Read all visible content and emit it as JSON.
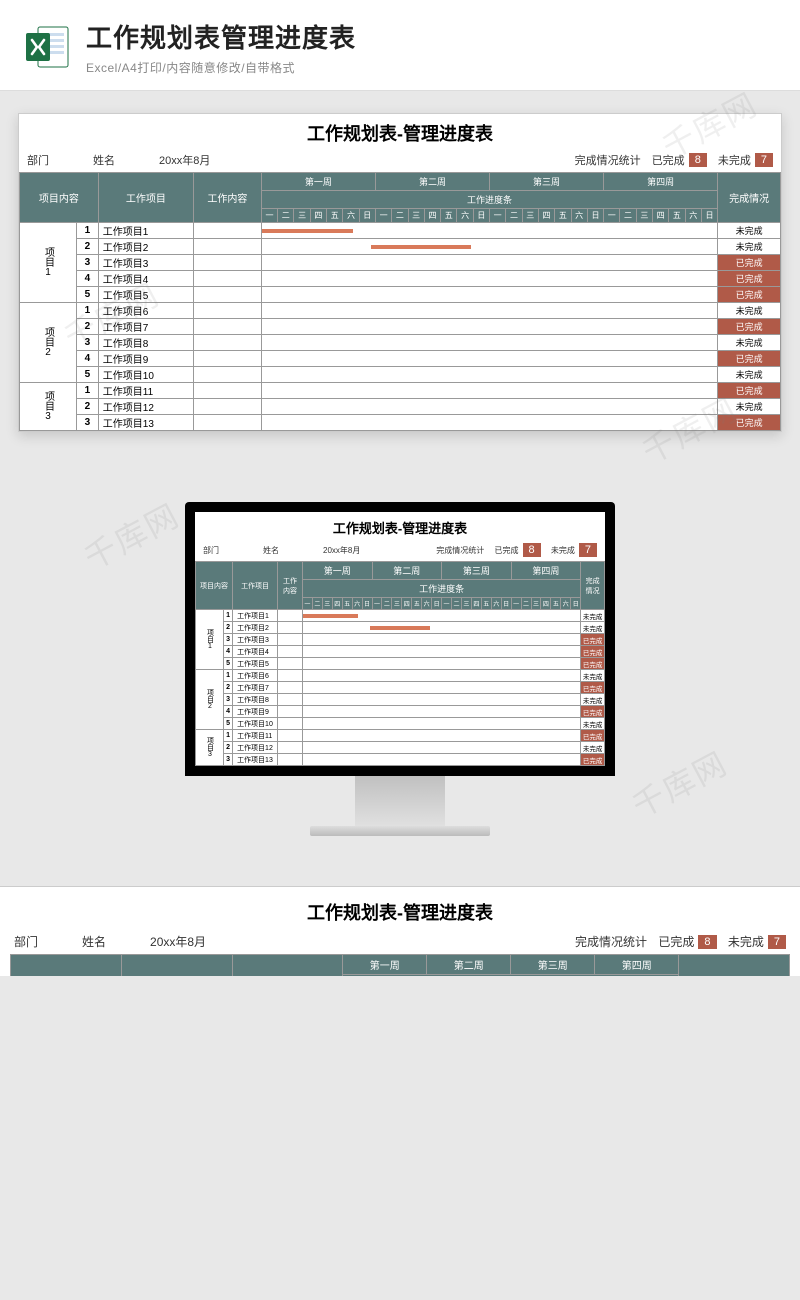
{
  "header": {
    "title": "工作规划表管理进度表",
    "subtitle": "Excel/A4打印/内容随意修改/自带格式"
  },
  "sheet": {
    "title": "工作规划表-管理进度表",
    "labels": {
      "dept": "部门",
      "name": "姓名",
      "date": "20xx年8月",
      "stats_label": "完成情况统计",
      "done_label": "已完成",
      "done_count": "8",
      "undone_label": "未完成",
      "undone_count": "7"
    },
    "cols": {
      "proj_content": "项目内容",
      "work_item": "工作项目",
      "work_content": "工作内容",
      "weeks": [
        "第一周",
        "第二周",
        "第三周",
        "第四周"
      ],
      "progress_bar": "工作进度条",
      "status": "完成情况",
      "days": [
        "一",
        "二",
        "三",
        "四",
        "五",
        "六",
        "日",
        "一",
        "二",
        "三",
        "四",
        "五",
        "六",
        "日",
        "一",
        "二",
        "三",
        "四",
        "五",
        "六",
        "日",
        "一",
        "二",
        "三",
        "四",
        "五",
        "六",
        "日"
      ]
    },
    "status_text": {
      "done": "已完成",
      "undone": "未完成"
    },
    "groups": [
      {
        "label": "项目1",
        "rows": [
          {
            "idx": "1",
            "task": "工作项目1",
            "status": "undone",
            "bar": {
              "start": 0,
              "len": 20
            }
          },
          {
            "idx": "2",
            "task": "工作项目2",
            "status": "undone",
            "bar": {
              "start": 24,
              "len": 22
            }
          },
          {
            "idx": "3",
            "task": "工作项目3",
            "status": "done"
          },
          {
            "idx": "4",
            "task": "工作项目4",
            "status": "done"
          },
          {
            "idx": "5",
            "task": "工作项目5",
            "status": "done"
          }
        ]
      },
      {
        "label": "项目2",
        "rows": [
          {
            "idx": "1",
            "task": "工作项目6",
            "status": "undone"
          },
          {
            "idx": "2",
            "task": "工作项目7",
            "status": "done"
          },
          {
            "idx": "3",
            "task": "工作项目8",
            "status": "undone"
          },
          {
            "idx": "4",
            "task": "工作项目9",
            "status": "done"
          },
          {
            "idx": "5",
            "task": "工作项目10",
            "status": "undone"
          }
        ]
      },
      {
        "label": "项目3",
        "rows": [
          {
            "idx": "1",
            "task": "工作项目11",
            "status": "done"
          },
          {
            "idx": "2",
            "task": "工作项目12",
            "status": "undone"
          },
          {
            "idx": "3",
            "task": "工作项目13",
            "status": "done"
          }
        ]
      }
    ]
  },
  "watermark": "千库网"
}
